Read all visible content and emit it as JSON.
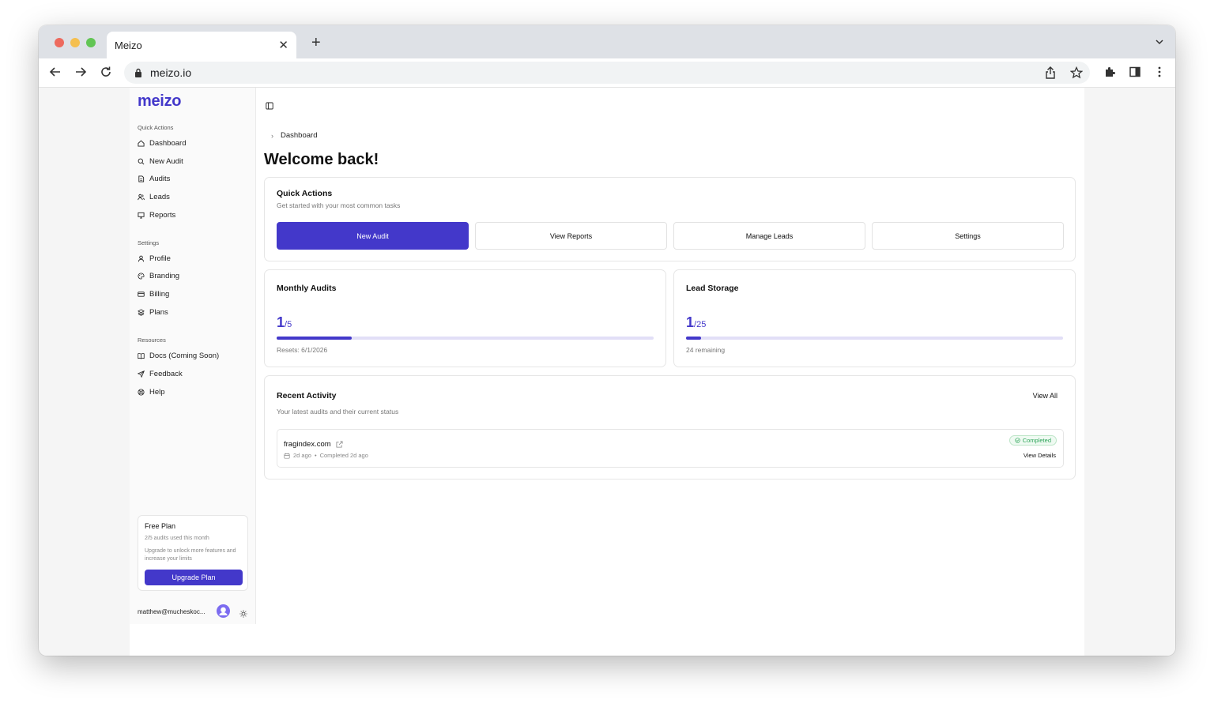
{
  "browser": {
    "tab_title": "Meizo",
    "url": "meizo.io"
  },
  "sidebar": {
    "logo": "meizo",
    "sections": [
      {
        "label": "Quick Actions",
        "items": [
          {
            "label": "Dashboard",
            "icon": "home-icon"
          },
          {
            "label": "New Audit",
            "icon": "search-icon"
          },
          {
            "label": "Audits",
            "icon": "document-icon"
          },
          {
            "label": "Leads",
            "icon": "users-icon"
          },
          {
            "label": "Reports",
            "icon": "presentation-icon"
          }
        ]
      },
      {
        "label": "Settings",
        "items": [
          {
            "label": "Profile",
            "icon": "user-icon"
          },
          {
            "label": "Branding",
            "icon": "palette-icon"
          },
          {
            "label": "Billing",
            "icon": "credit-card-icon"
          },
          {
            "label": "Plans",
            "icon": "layers-icon"
          }
        ]
      },
      {
        "label": "Resources",
        "items": [
          {
            "label": "Docs (Coming Soon)",
            "icon": "book-icon"
          },
          {
            "label": "Feedback",
            "icon": "send-icon"
          },
          {
            "label": "Help",
            "icon": "lifebuoy-icon"
          }
        ]
      }
    ],
    "plan": {
      "title": "Free Plan",
      "usage": "2/5 audits used this month",
      "description": "Upgrade to unlock more features and increase your limits",
      "button": "Upgrade Plan"
    },
    "user_email": "matthew@mucheskoc..."
  },
  "main": {
    "breadcrumb": "Dashboard",
    "heading": "Welcome back!",
    "quick_actions": {
      "title": "Quick Actions",
      "subtitle": "Get started with your most common tasks",
      "buttons": [
        "New Audit",
        "View Reports",
        "Manage Leads",
        "Settings"
      ]
    },
    "monthly_audits": {
      "title": "Monthly Audits",
      "used": "1",
      "limit": "/5",
      "progress": 0.2,
      "caption": "Resets: 6/1/2026"
    },
    "lead_storage": {
      "title": "Lead Storage",
      "used": "1",
      "limit": "/25",
      "progress": 0.04,
      "caption": "24 remaining"
    },
    "recent_activity": {
      "title": "Recent Activity",
      "subtitle": "Your latest audits and their current status",
      "view_all": "View All",
      "items": [
        {
          "domain": "fragindex.com",
          "created": "2d ago",
          "separator": "•",
          "completed": "Completed 2d ago",
          "status": "Completed",
          "action": "View Details"
        }
      ]
    }
  },
  "colors": {
    "accent": "#4338ca",
    "success": "#2fa55a"
  }
}
